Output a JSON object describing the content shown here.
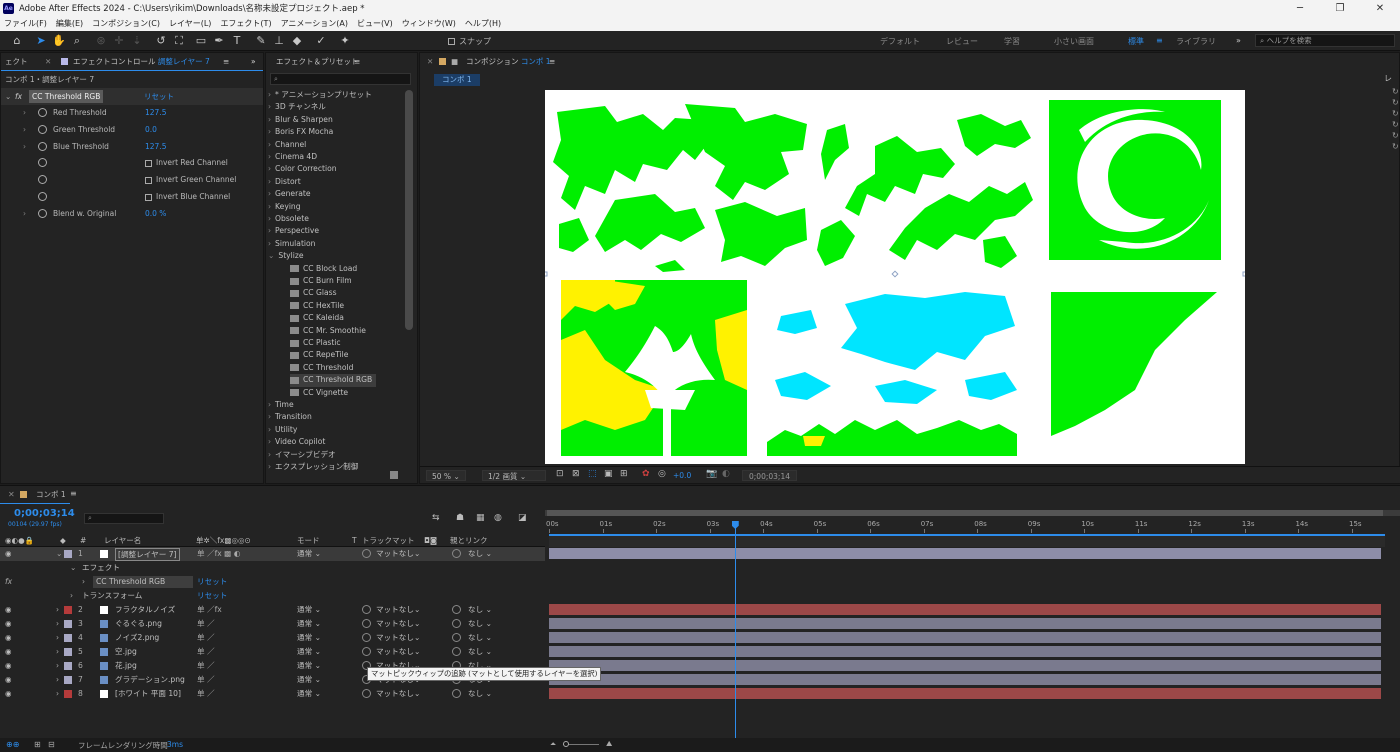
{
  "window": {
    "title": "Adobe After Effects 2024 - C:\\Users\\rikim\\Downloads\\名称未設定プロジェクト.aep *",
    "app_icon": "Ae"
  },
  "menu": [
    "ファイル(F)",
    "編集(E)",
    "コンポジション(C)",
    "レイヤー(L)",
    "エフェクト(T)",
    "アニメーション(A)",
    "ビュー(V)",
    "ウィンドウ(W)",
    "ヘルプ(H)"
  ],
  "toolbar": {
    "snap_label": "スナップ",
    "workspaces": [
      "デフォルト",
      "レビュー",
      "学習",
      "小さい画面",
      "標準",
      "ライブラリ"
    ],
    "active_workspace": "標準",
    "more": "»",
    "help_placeholder": "ヘルプを検索"
  },
  "effect_controls": {
    "left_tab": "ェクト",
    "tab_title": "エフェクトコントロール",
    "tab_target": "調整レイヤー 7",
    "breadcrumb": "コンポ 1・調整レイヤー 7",
    "effect_name": "CC Threshold RGB",
    "reset": "リセット",
    "params": [
      {
        "name": "Red Threshold",
        "value": "127.5"
      },
      {
        "name": "Green Threshold",
        "value": "0.0"
      },
      {
        "name": "Blue Threshold",
        "value": "127.5"
      }
    ],
    "checkboxes": [
      "Invert Red Channel",
      "Invert Green Channel",
      "Invert Blue Channel"
    ],
    "blend": {
      "name": "Blend w. Original",
      "value": "0.0 %"
    }
  },
  "effects_presets": {
    "tab": "エフェクト＆プリセット",
    "categories_top": [
      "* アニメーションプリセット",
      "3D チャンネル",
      "Blur & Sharpen",
      "Boris FX Mocha",
      "Channel",
      "Cinema 4D",
      "Color Correction",
      "Distort",
      "Generate",
      "Keying",
      "Obsolete",
      "Perspective",
      "Simulation",
      "Stylize"
    ],
    "stylize_items": [
      "CC Block Load",
      "CC Burn Film",
      "CC Glass",
      "CC HexTile",
      "CC Kaleida",
      "CC Mr. Smoothie",
      "CC Plastic",
      "CC RepeTile",
      "CC Threshold",
      "CC Threshold RGB",
      "CC Vignette"
    ],
    "selected_item": "CC Threshold RGB",
    "categories_bottom": [
      "Time",
      "Transition",
      "Utility",
      "Video Copilot",
      "イマーシブビデオ",
      "エクスプレッション制御"
    ]
  },
  "composition": {
    "tab": "コンポジション",
    "tab_name": "コンポ 1",
    "subtab": "コンポ 1",
    "zoom": "50 %",
    "resolution": "1/2 画質",
    "exposure": "+0.0",
    "timecode": "0;00;03;14"
  },
  "timeline": {
    "tab": "コンポ 1",
    "timecode": "0;00;03;14",
    "frames": "00104 (29.97 fps)",
    "headers": {
      "layer_name": "レイヤー名",
      "mode": "モード",
      "t": "T",
      "track_matte": "トラックマット",
      "parent": "親とリンク"
    },
    "ruler": [
      "00s",
      "01s",
      "02s",
      "03s",
      "04s",
      "05s",
      "06s",
      "07s",
      "08s",
      "09s",
      "10s",
      "11s",
      "12s",
      "13s",
      "14s",
      "15s"
    ],
    "playhead_time_s": 3.47,
    "end_time_s": 15.5,
    "layer1": {
      "num": "1",
      "name": "[調整レイヤー 7]",
      "mode": "通常",
      "matte": "マットなし",
      "parent": "なし"
    },
    "effect_group": "エフェクト",
    "fx_label": "fx",
    "effect_item": "CC Threshold RGB",
    "reset": "リセット",
    "transform": "トランスフォーム",
    "layers": [
      {
        "num": "2",
        "name": "フラクタルノイズ",
        "mode": "通常",
        "matte": "マットなし",
        "parent": "なし",
        "color": "#b53b3b"
      },
      {
        "num": "3",
        "name": "ぐるぐる.png",
        "mode": "通常",
        "matte": "マットなし",
        "parent": "なし",
        "color": "#a8a8c4"
      },
      {
        "num": "4",
        "name": "ノイズ2.png",
        "mode": "通常",
        "matte": "マットなし",
        "parent": "なし",
        "color": "#a8a8c4"
      },
      {
        "num": "5",
        "name": "空.jpg",
        "mode": "通常",
        "matte": "マットなし",
        "parent": "なし",
        "color": "#a8a8c4"
      },
      {
        "num": "6",
        "name": "花.jpg",
        "mode": "通常",
        "matte": "マットなし",
        "parent": "なし",
        "color": "#a8a8c4"
      },
      {
        "num": "7",
        "name": "グラデーション.png",
        "mode": "通常",
        "matte": "マットなし",
        "parent": "なし",
        "color": "#a8a8c4"
      },
      {
        "num": "8",
        "name": "[ホワイト 平面 10]",
        "mode": "通常",
        "matte": "マットなし",
        "parent": "なし",
        "color": "#b53b3b"
      }
    ],
    "tooltip": "マットピックウィップの追跡 (マットとして使用するレイヤーを選択)"
  },
  "status": {
    "label": "フレームレンダリング時間",
    "value": "3ms"
  }
}
